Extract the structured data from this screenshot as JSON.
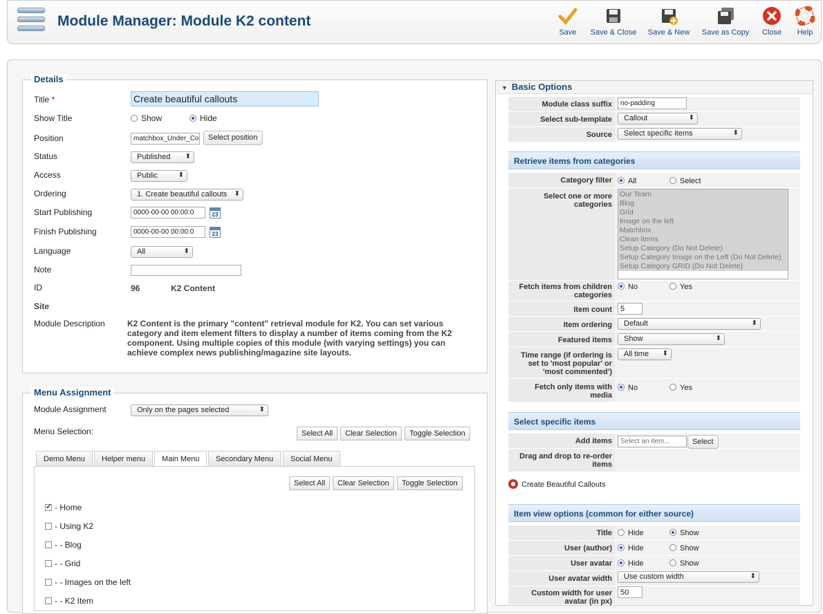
{
  "header": {
    "title": "Module Manager: Module K2 content"
  },
  "toolbar": [
    {
      "label": "Save",
      "icon": "save-check-icon"
    },
    {
      "label": "Save & Close",
      "icon": "floppy-icon"
    },
    {
      "label": "Save & New",
      "icon": "floppy-new-icon"
    },
    {
      "label": "Save as Copy",
      "icon": "floppy-copy-icon"
    },
    {
      "label": "Close",
      "icon": "close-icon"
    },
    {
      "label": "Help",
      "icon": "help-lifebuoy-icon"
    }
  ],
  "details": {
    "legend": "Details",
    "title_label": "Title",
    "required_mark": "*",
    "title_value": "Create beautiful callouts",
    "show_title_label": "Show Title",
    "show_option": "Show",
    "hide_option": "Hide",
    "position_label": "Position",
    "position_value": "matchbox_Under_Co",
    "select_position": "Select position",
    "status_label": "Status",
    "status_value": "Published",
    "access_label": "Access",
    "access_value": "Public",
    "ordering_label": "Ordering",
    "ordering_value": "1. Create beautiful callouts",
    "start_label": "Start Publishing",
    "start_value": "0000-00-00 00:00:0",
    "finish_label": "Finish Publishing",
    "finish_value": "0000-00-00 00:00:0",
    "calendar_day": "23",
    "language_label": "Language",
    "language_value": "All",
    "note_label": "Note",
    "note_value": "",
    "id_label": "ID",
    "id_value": "96",
    "module_type": "K2 Content",
    "site_label": "Site",
    "desc_label": "Module Description",
    "desc_text": "K2 Content is the primary \"content\" retrieval module for K2. You can set various category and item element filters to display a number of items coming from the K2 component. Using multiple copies of this module (with varying settings) you can achieve complex news publishing/magazine site layouts."
  },
  "menu_assignment": {
    "legend": "Menu Assignment",
    "module_assignment_label": "Module Assignment",
    "module_assignment_value": "Only on the pages selected",
    "menu_selection_label": "Menu Selection:",
    "select_all": "Select All",
    "clear_selection": "Clear Selection",
    "toggle_selection": "Toggle Selection",
    "tabs": [
      "Demo Menu",
      "Helper menu",
      "Main Menu",
      "Secondary Menu",
      "Social Menu"
    ],
    "items": [
      {
        "label": "- Home",
        "checked": true
      },
      {
        "label": "- Using K2",
        "checked": false
      },
      {
        "label": "- - Blog",
        "checked": false
      },
      {
        "label": "- - Grid",
        "checked": false
      },
      {
        "label": "- - Images on the left",
        "checked": false
      },
      {
        "label": "- - K2 Item",
        "checked": false
      }
    ]
  },
  "basic_options": {
    "header": "Basic Options",
    "class_suffix_label": "Module class suffix",
    "class_suffix_value": "no-padding",
    "subtemplate_label": "Select sub-template",
    "subtemplate_value": "Callout",
    "source_label": "Source",
    "source_value": "Select specific items"
  },
  "retrieve": {
    "header": "Retrieve items from categories",
    "category_filter_label": "Category filter",
    "all_option": "All",
    "select_option": "Select",
    "select_categories_label": "Select one or more categories",
    "categories": [
      "Our Team",
      "Blog",
      "Grid",
      "Image on the left",
      "Matchbox",
      "Clean Items",
      "Setup Category (Do Not Delete)",
      "Setup Category Image on the Left (Do Not Delete)",
      "Setup Category GRID (Do Not Delete)"
    ],
    "fetch_children_label": "Fetch items from children categories",
    "no_option": "No",
    "yes_option": "Yes",
    "item_count_label": "Item count",
    "item_count_value": "5",
    "item_ordering_label": "Item ordering",
    "item_ordering_value": "Default",
    "featured_label": "Featured items",
    "featured_value": "Show",
    "time_range_label": "Time range (if ordering is set to 'most popular' or 'most commented')",
    "time_range_value": "All time",
    "media_label": "Fetch only items with media"
  },
  "specific": {
    "header": "Select specific items",
    "add_items_label": "Add items",
    "add_items_placeholder": "Select an item...",
    "select_button": "Select",
    "drag_label": "Drag and drop to re-order items",
    "selected_item": "Create Beautiful Callouts"
  },
  "item_view": {
    "header": "Item view options (common for either source)",
    "title_label": "Title",
    "user_author_label": "User (author)",
    "user_avatar_label": "User avatar",
    "hide_option": "Hide",
    "show_option": "Show",
    "avatar_width_label": "User avatar width",
    "avatar_width_value": "Use custom width",
    "custom_width_label": "Custom width for user avatar (in px)",
    "custom_width_value": "50"
  },
  "colors": {
    "title": "#1a4a7a",
    "accent": "#1f5fb0",
    "remove": "#c0392b"
  }
}
